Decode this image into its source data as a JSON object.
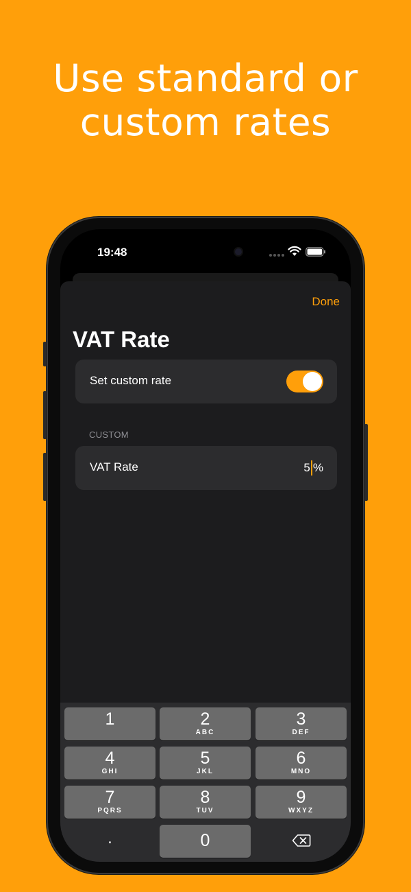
{
  "headline": {
    "line1": "Use standard or",
    "line2": "custom rates"
  },
  "status_bar": {
    "time": "19:48"
  },
  "sheet": {
    "done_label": "Done",
    "title": "VAT Rate"
  },
  "custom_toggle": {
    "label": "Set custom rate",
    "on": true
  },
  "custom_section": {
    "header": "CUSTOM",
    "row_label": "VAT Rate",
    "value": "5",
    "unit": "%"
  },
  "keypad": {
    "keys": [
      {
        "num": "1",
        "letters": ""
      },
      {
        "num": "2",
        "letters": "ABC"
      },
      {
        "num": "3",
        "letters": "DEF"
      },
      {
        "num": "4",
        "letters": "GHI"
      },
      {
        "num": "5",
        "letters": "JKL"
      },
      {
        "num": "6",
        "letters": "MNO"
      },
      {
        "num": "7",
        "letters": "PQRS"
      },
      {
        "num": "8",
        "letters": "TUV"
      },
      {
        "num": "9",
        "letters": "WXYZ"
      },
      {
        "num": "0",
        "letters": ""
      }
    ],
    "decimal": "."
  },
  "colors": {
    "accent": "#FF9F0A",
    "sheet_bg": "#1c1c1e",
    "card_bg": "#2c2c2e",
    "key_bg": "#6b6b6b"
  },
  "icons": {
    "wifi": "wifi-icon",
    "battery": "battery-icon",
    "delete": "delete-backspace-icon"
  }
}
